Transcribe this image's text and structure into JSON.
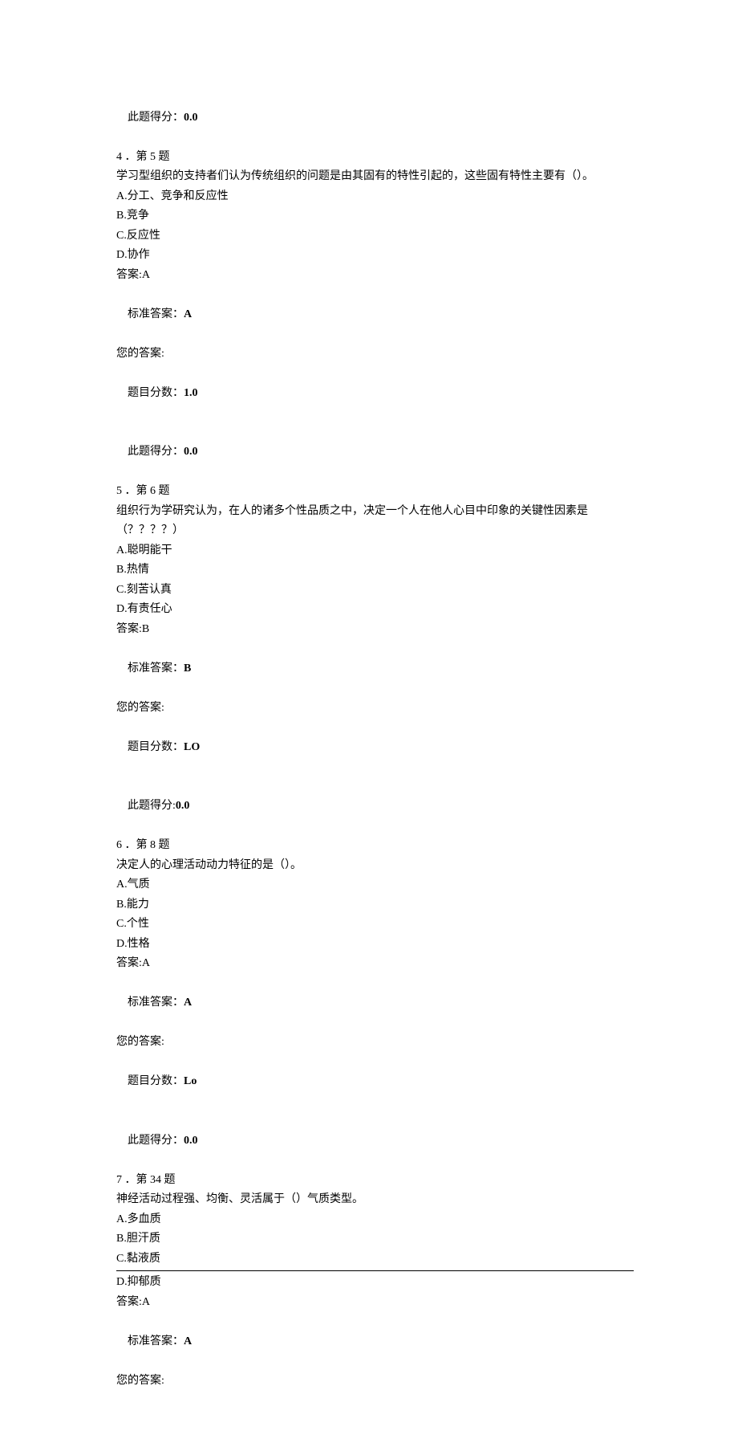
{
  "q3_tail": {
    "score_earned_label": "此题得分：",
    "score_earned": "0.0"
  },
  "q4": {
    "num_line": "4 ．第 5 题",
    "stem": "学习型组织的支持者们认为传统组织的问题是由其固有的特性引起的，这些固有特性主要有（）。",
    "optA": "A.分工、竞争和反应性",
    "optB": "B.竞争",
    "optC": "C.反应性",
    "optD": "D.协作",
    "answer_line": "答案:A",
    "std_label": "标准答案：",
    "std_value": "A",
    "your_label": "您的答案:",
    "item_score_label": "题目分数：",
    "item_score": "1.0",
    "earned_label": "此题得分：",
    "earned": "0.0"
  },
  "q5": {
    "num_line": "5 ．第 6 题",
    "stem1": "组织行为学研究认为，在人的诸多个性品质之中，决定一个人在他人心目中印象的关键性因素是",
    "stem2": "（？？？？）",
    "optA": "A.聪明能干",
    "optB": "B.热情",
    "optC": "C.刻苦认真",
    "optD": "D.有责任心",
    "answer_line": "答案:B",
    "std_label": "标准答案：",
    "std_value": "B",
    "your_label": "您的答案:",
    "item_score_label": "题目分数：",
    "item_score": "LO",
    "earned_label": "此题得分:",
    "earned": "0.0"
  },
  "q6": {
    "num_line": "6 ．第 8 题",
    "stem": "决定人的心理活动动力特征的是（）。",
    "optA": "A.气质",
    "optB": "B.能力",
    "optC": "C.个性",
    "optD": "D.性格",
    "answer_line": "答案:A",
    "std_label": "标准答案：",
    "std_value": "A",
    "your_label": "您的答案:",
    "item_score_label": "题目分数：",
    "item_score": "Lo",
    "earned_label": "此题得分：",
    "earned": "0.0"
  },
  "q7": {
    "num_line": "7 ．第 34 题",
    "stem": "神经活动过程强、均衡、灵活属于（）气质类型。",
    "optA": "A.多血质",
    "optB": "B.胆汗质",
    "optC": "C.黏液质",
    "optD": "D.抑郁质",
    "answer_line": "答案:A",
    "std_label": "标准答案：",
    "std_value": "A",
    "your_label": "您的答案:"
  }
}
